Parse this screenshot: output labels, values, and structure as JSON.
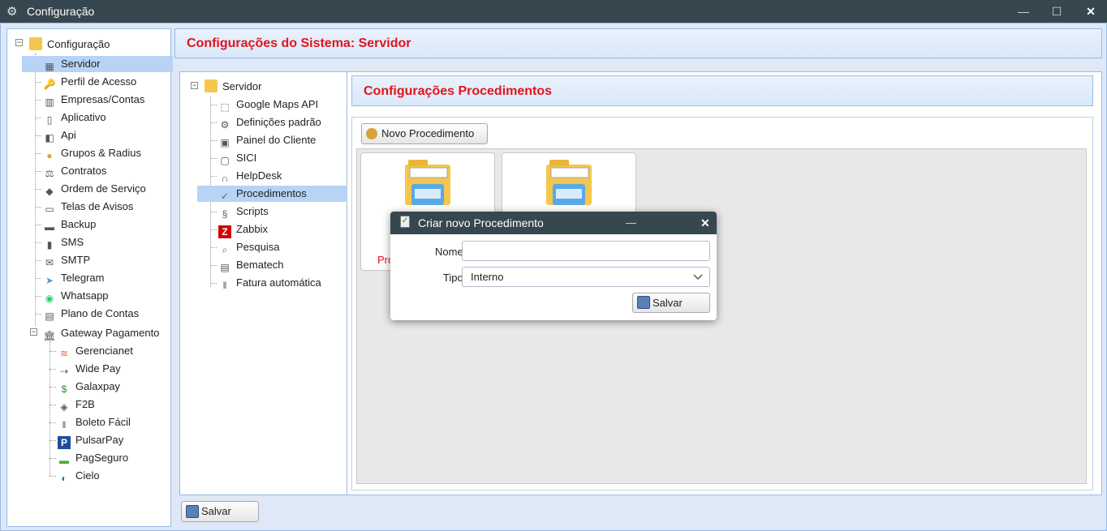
{
  "window": {
    "title": "Configuração",
    "icon": "gear-icon"
  },
  "left_tree": {
    "root": {
      "label": "Configuração",
      "icon": "folder-icon"
    },
    "items": [
      {
        "label": "Servidor",
        "icon": "server-icon",
        "selected": true
      },
      {
        "label": "Perfil de Acesso",
        "icon": "key-icon"
      },
      {
        "label": "Empresas/Contas",
        "icon": "building-icon"
      },
      {
        "label": "Aplicativo",
        "icon": "mobile-icon"
      },
      {
        "label": "Api",
        "icon": "api-icon"
      },
      {
        "label": "Grupos & Radius",
        "icon": "coins-icon"
      },
      {
        "label": "Contratos",
        "icon": "scale-icon"
      },
      {
        "label": "Ordem de Serviço",
        "icon": "tag-icon"
      },
      {
        "label": "Telas de Avisos",
        "icon": "monitor-icon"
      },
      {
        "label": "Backup",
        "icon": "tape-icon"
      },
      {
        "label": "SMS",
        "icon": "phone-icon"
      },
      {
        "label": "SMTP",
        "icon": "mail-icon"
      },
      {
        "label": "Telegram",
        "icon": "telegram-icon"
      },
      {
        "label": "Whatsapp",
        "icon": "whatsapp-icon"
      },
      {
        "label": "Plano de Contas",
        "icon": "ledger-icon"
      }
    ],
    "gateway": {
      "label": "Gateway Pagamento",
      "icon": "bank-icon",
      "children": [
        {
          "label": "Gerencianet",
          "icon": "gerencianet-icon"
        },
        {
          "label": "Wide Pay",
          "icon": "widepay-icon"
        },
        {
          "label": "Galaxpay",
          "icon": "galaxpay-icon"
        },
        {
          "label": "F2B",
          "icon": "f2b-icon"
        },
        {
          "label": "Boleto Fácil",
          "icon": "barcode-icon"
        },
        {
          "label": "PulsarPay",
          "icon": "pulsarpay-icon"
        },
        {
          "label": "PagSeguro",
          "icon": "pagseguro-icon"
        },
        {
          "label": "Cielo",
          "icon": "cielo-icon"
        }
      ]
    }
  },
  "main": {
    "header": "Configurações do Sistema: Servidor",
    "server_tree": {
      "root": {
        "label": "Servidor",
        "icon": "folder-icon"
      },
      "items": [
        {
          "label": "Google Maps API",
          "icon": "map-icon"
        },
        {
          "label": "Definições padrão",
          "icon": "gear-icon"
        },
        {
          "label": "Painel do Cliente",
          "icon": "panel-icon"
        },
        {
          "label": "SICI",
          "icon": "document-icon"
        },
        {
          "label": "HelpDesk",
          "icon": "headset-icon"
        },
        {
          "label": "Procedimentos",
          "icon": "clipboard-icon",
          "selected": true
        },
        {
          "label": "Scripts",
          "icon": "script-icon"
        },
        {
          "label": "Zabbix",
          "icon": "zabbix-icon"
        },
        {
          "label": "Pesquisa",
          "icon": "search-icon"
        },
        {
          "label": "Bematech",
          "icon": "printer-icon"
        },
        {
          "label": "Fatura automática",
          "icon": "barcode-icon"
        }
      ]
    },
    "procedures": {
      "header": "Configurações Procedimentos",
      "new_button": "Novo Procedimento",
      "card_label_partial": "Pro"
    },
    "save_button": "Salvar"
  },
  "dialog": {
    "title": "Criar novo Procedimento",
    "minimize": "—",
    "close": "✕",
    "name_label": "Nome:",
    "name_value": "",
    "type_label": "Tipo:",
    "type_value": "Interno",
    "required_mark": "*",
    "save_button": "Salvar"
  },
  "colors": {
    "accent": "#e0151c",
    "titlebar": "#37474f",
    "selection": "#b7d3f5",
    "frame": "#dfe8f6"
  }
}
